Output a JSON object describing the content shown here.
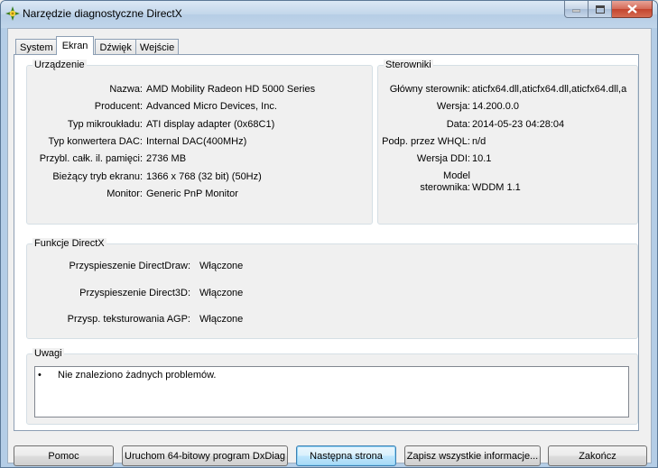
{
  "window": {
    "title": "Narzędzie diagnostyczne DirectX",
    "icon": "directx-icon"
  },
  "caption_buttons": {
    "minimize": "minimize-icon",
    "maximize": "maximize-icon",
    "close": "close-icon"
  },
  "tabs": [
    {
      "label": "System",
      "active": false
    },
    {
      "label": "Ekran",
      "active": true
    },
    {
      "label": "Dźwięk",
      "active": false
    },
    {
      "label": "Wejście",
      "active": false
    }
  ],
  "device": {
    "title": "Urządzenie",
    "rows": [
      {
        "label": "Nazwa:",
        "value": "AMD Mobility Radeon HD 5000 Series"
      },
      {
        "label": "Producent:",
        "value": "Advanced Micro Devices, Inc."
      },
      {
        "label": "Typ mikroukładu:",
        "value": "ATI display adapter (0x68C1)"
      },
      {
        "label": "Typ konwertera DAC:",
        "value": "Internal DAC(400MHz)"
      },
      {
        "label": "Przybl. całk. il. pamięci:",
        "value": "2736 MB"
      },
      {
        "label": "Bieżący tryb ekranu:",
        "value": "1366 x 768 (32 bit) (50Hz)"
      },
      {
        "label": "Monitor:",
        "value": "Generic PnP Monitor"
      }
    ]
  },
  "drivers": {
    "title": "Sterowniki",
    "rows": [
      {
        "label": "Główny sterownik:",
        "value": "aticfx64.dll,aticfx64.dll,aticfx64.dll,a"
      },
      {
        "label": "Wersja:",
        "value": "14.200.0.0"
      },
      {
        "label": "Data:",
        "value": "2014-05-23 04:28:04"
      },
      {
        "label": "Podp. przez WHQL:",
        "value": "n/d"
      },
      {
        "label": "Wersja DDI:",
        "value": "10.1"
      },
      {
        "label_line1": "Model",
        "label_line2": "sterownika:",
        "value": "WDDM 1.1"
      }
    ]
  },
  "directx": {
    "title": "Funkcje DirectX",
    "rows": [
      {
        "label": "Przyspieszenie DirectDraw:",
        "value": "Włączone"
      },
      {
        "label": "Przyspieszenie Direct3D:",
        "value": "Włączone"
      },
      {
        "label": "Przysp. teksturowania AGP:",
        "value": "Włączone"
      }
    ]
  },
  "notes": {
    "title": "Uwagi",
    "items": [
      "Nie znaleziono żadnych problemów."
    ]
  },
  "buttons": {
    "help": "Pomoc",
    "run64": "Uruchom 64-bitowy program DxDiag",
    "next": "Następna strona",
    "save": "Zapisz wszystkie informacje...",
    "exit": "Zakończ"
  }
}
